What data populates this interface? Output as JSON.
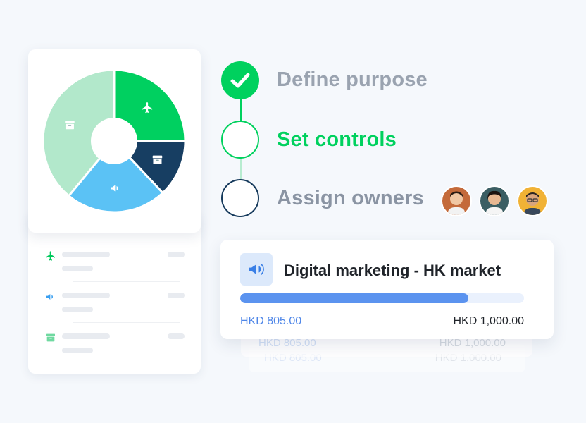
{
  "steps": [
    {
      "label": "Define purpose",
      "state": "done",
      "color": "#9aa3b0"
    },
    {
      "label": "Set controls",
      "state": "active",
      "color": "#00d15e"
    },
    {
      "label": "Assign owners",
      "state": "pending",
      "color": "#8a94a3"
    }
  ],
  "owners": [
    {
      "name": "owner-1",
      "bg": "#c46a3a"
    },
    {
      "name": "owner-2",
      "bg": "#3b5e63"
    },
    {
      "name": "owner-3",
      "bg": "#f1b235"
    }
  ],
  "pie": {
    "slices": [
      {
        "name": "travel",
        "value": 25,
        "color": "#00d060",
        "icon": "airplane-icon"
      },
      {
        "name": "office",
        "value": 13,
        "color": "#173e62",
        "icon": "archive-box-icon"
      },
      {
        "name": "marketing",
        "value": 23,
        "color": "#5bc2f5",
        "icon": "megaphone-icon"
      },
      {
        "name": "storage",
        "value": 39,
        "color": "#b2e8cb",
        "icon": "archive-box-icon"
      }
    ]
  },
  "list": [
    {
      "icon": "airplane-icon",
      "color": "#00c95c"
    },
    {
      "icon": "megaphone-icon",
      "color": "#3a9ff0"
    },
    {
      "icon": "archive-box-icon",
      "color": "#6fd9a0"
    }
  ],
  "budget": {
    "title": "Digital marketing - HK market",
    "spent": "HKD 805.00",
    "total": "HKD 1,000.00",
    "progress": 0.805,
    "icon": "megaphone-icon"
  },
  "ghost_rows": [
    {
      "spent": "HKD 805.00",
      "total": "HKD 1,000.00"
    },
    {
      "spent": "HKD 805.00",
      "total": "HKD 1,000.00"
    }
  ]
}
